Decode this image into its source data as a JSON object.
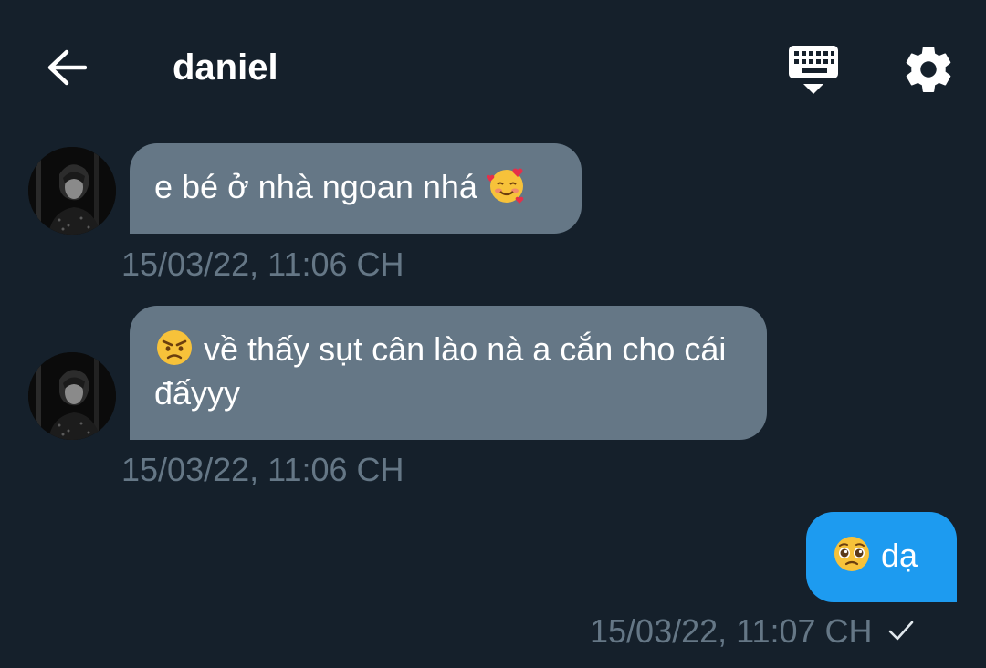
{
  "header": {
    "title": "daniel",
    "back_icon": "arrow-left-icon",
    "keyboard_icon": "keyboard-icon",
    "settings_icon": "gear-icon"
  },
  "messages": [
    {
      "direction": "incoming",
      "text": "e bé ở nhà ngoan nhá",
      "emoji": "smiling-face-with-hearts-icon",
      "timestamp": "15/03/22, 11:06 CH"
    },
    {
      "direction": "incoming",
      "emoji": "angry-face-icon",
      "text": "về thấy sụt cân lào nà a cắn cho cái đấyyy",
      "timestamp": "15/03/22, 11:06 CH"
    },
    {
      "direction": "outgoing",
      "emoji": "pleading-face-icon",
      "text": "dạ",
      "timestamp": "15/03/22, 11:07 CH",
      "status_icon": "checkmark-icon"
    }
  ],
  "colors": {
    "background": "#15202b",
    "incoming_bubble": "#657786",
    "outgoing_bubble": "#1d9bf0",
    "timestamp": "#657786"
  }
}
